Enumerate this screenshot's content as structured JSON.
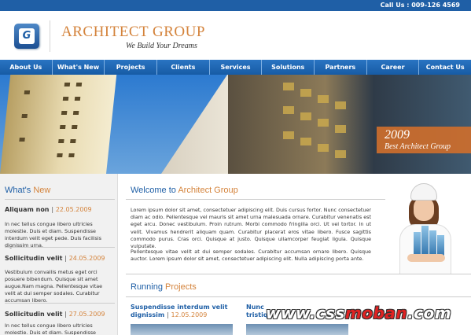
{
  "topbar": {
    "call_us": "Call Us : 009-126 4569"
  },
  "header": {
    "logo_letter": "G",
    "brand": "ARCHITECT GROUP",
    "tagline": "We Build Your Dreams"
  },
  "nav": {
    "items": [
      "About Us",
      "What's New",
      "Projects",
      "Clients",
      "Services",
      "Solutions",
      "Partners",
      "Career",
      "Contact Us"
    ]
  },
  "banner": {
    "year": "2009",
    "award": "Best Architect Group"
  },
  "whats_new": {
    "title_main": "What's",
    "title_accent": "New",
    "items": [
      {
        "title": "Aliquam non",
        "date": "22.05.2009",
        "body": "In nec tellus congue libero ultricies molestie. Duis et diam. Suspendisse interdum velit eget pede. Duis facilisis dignissim urna."
      },
      {
        "title": "Sollicitudin velit",
        "date": "24.05.2009",
        "body": "Vestibulum convallis metus eget orci posuere bibendum. Quisque sit amet augue.Nam magna. Pellentesque vitae velit at dui semper sodales. Curabitur accumsan libero."
      },
      {
        "title": "Sollicitudin velit",
        "date": "27.05.2009",
        "body": "In nec tellus congue libero ultricies molestie. Duis et diam. Suspendisse interdum velit eget"
      }
    ]
  },
  "welcome": {
    "title_main": "Welcome to",
    "title_accent": "Architect Group",
    "paragraph1": "Lorem ipsum dolor sit amet, consectetuer adipiscing elit. Duis cursus fortor. Nunc consectetuer diam ac odio. Pellentesque vel mauris sit amet urna malesuada ornare. Curabitur venenatis est eget arcu. Donec vestibulum. Proin rutrum. Morbi commodo fringilla orci. Ut vel tortor. In ut velit. Vivamus hendrerit aliquam quam. Curabitur placerat eros vitae libero. Fusce sagittis commodo purus. Cras orci. Quisque at justo. Quisque ullamcorper feugiat ligula. Quisque vulputate.",
    "paragraph2": "Pellentesque vitae velit at dui semper sodales. Curabitur accumsan ornare libero. Quisque auctor. Lorem ipsum dolor sit amet, consectetuer adipiscing elit. Nulla adipiscing porta ante."
  },
  "running_projects": {
    "title_main": "Running",
    "title_accent": "Projects",
    "items": [
      {
        "title_line1": "Suspendisse interdum velit",
        "title_line2": "dignissim",
        "date": "12.05.2009"
      },
      {
        "title_line1": "Nunc",
        "title_line2": "tristiq",
        "date": ""
      }
    ]
  },
  "watermark": {
    "left": "www.css",
    "mid": "moban",
    "right": ".com"
  }
}
